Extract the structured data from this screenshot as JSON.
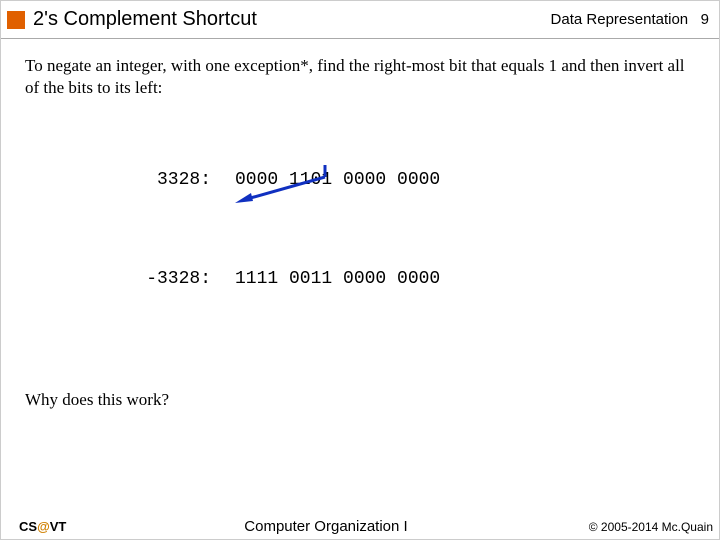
{
  "header": {
    "title": "2's Complement Shortcut",
    "section": "Data Representation",
    "page": "9"
  },
  "intro": "To negate an integer, with one exception*, find the right-most bit that equals 1 and then invert all of the bits to its left:",
  "rows": [
    {
      "label": " 3328:",
      "bits": "0000 1101 0000 0000"
    },
    {
      "label": "-3328:",
      "bits": "1111 0011 0000 0000"
    }
  ],
  "question": "Why does this work?",
  "footer": {
    "left_a": "CS",
    "left_at": "@",
    "left_b": "VT",
    "center": "Computer Organization I",
    "right": "© 2005-2014 Mc.Quain"
  }
}
